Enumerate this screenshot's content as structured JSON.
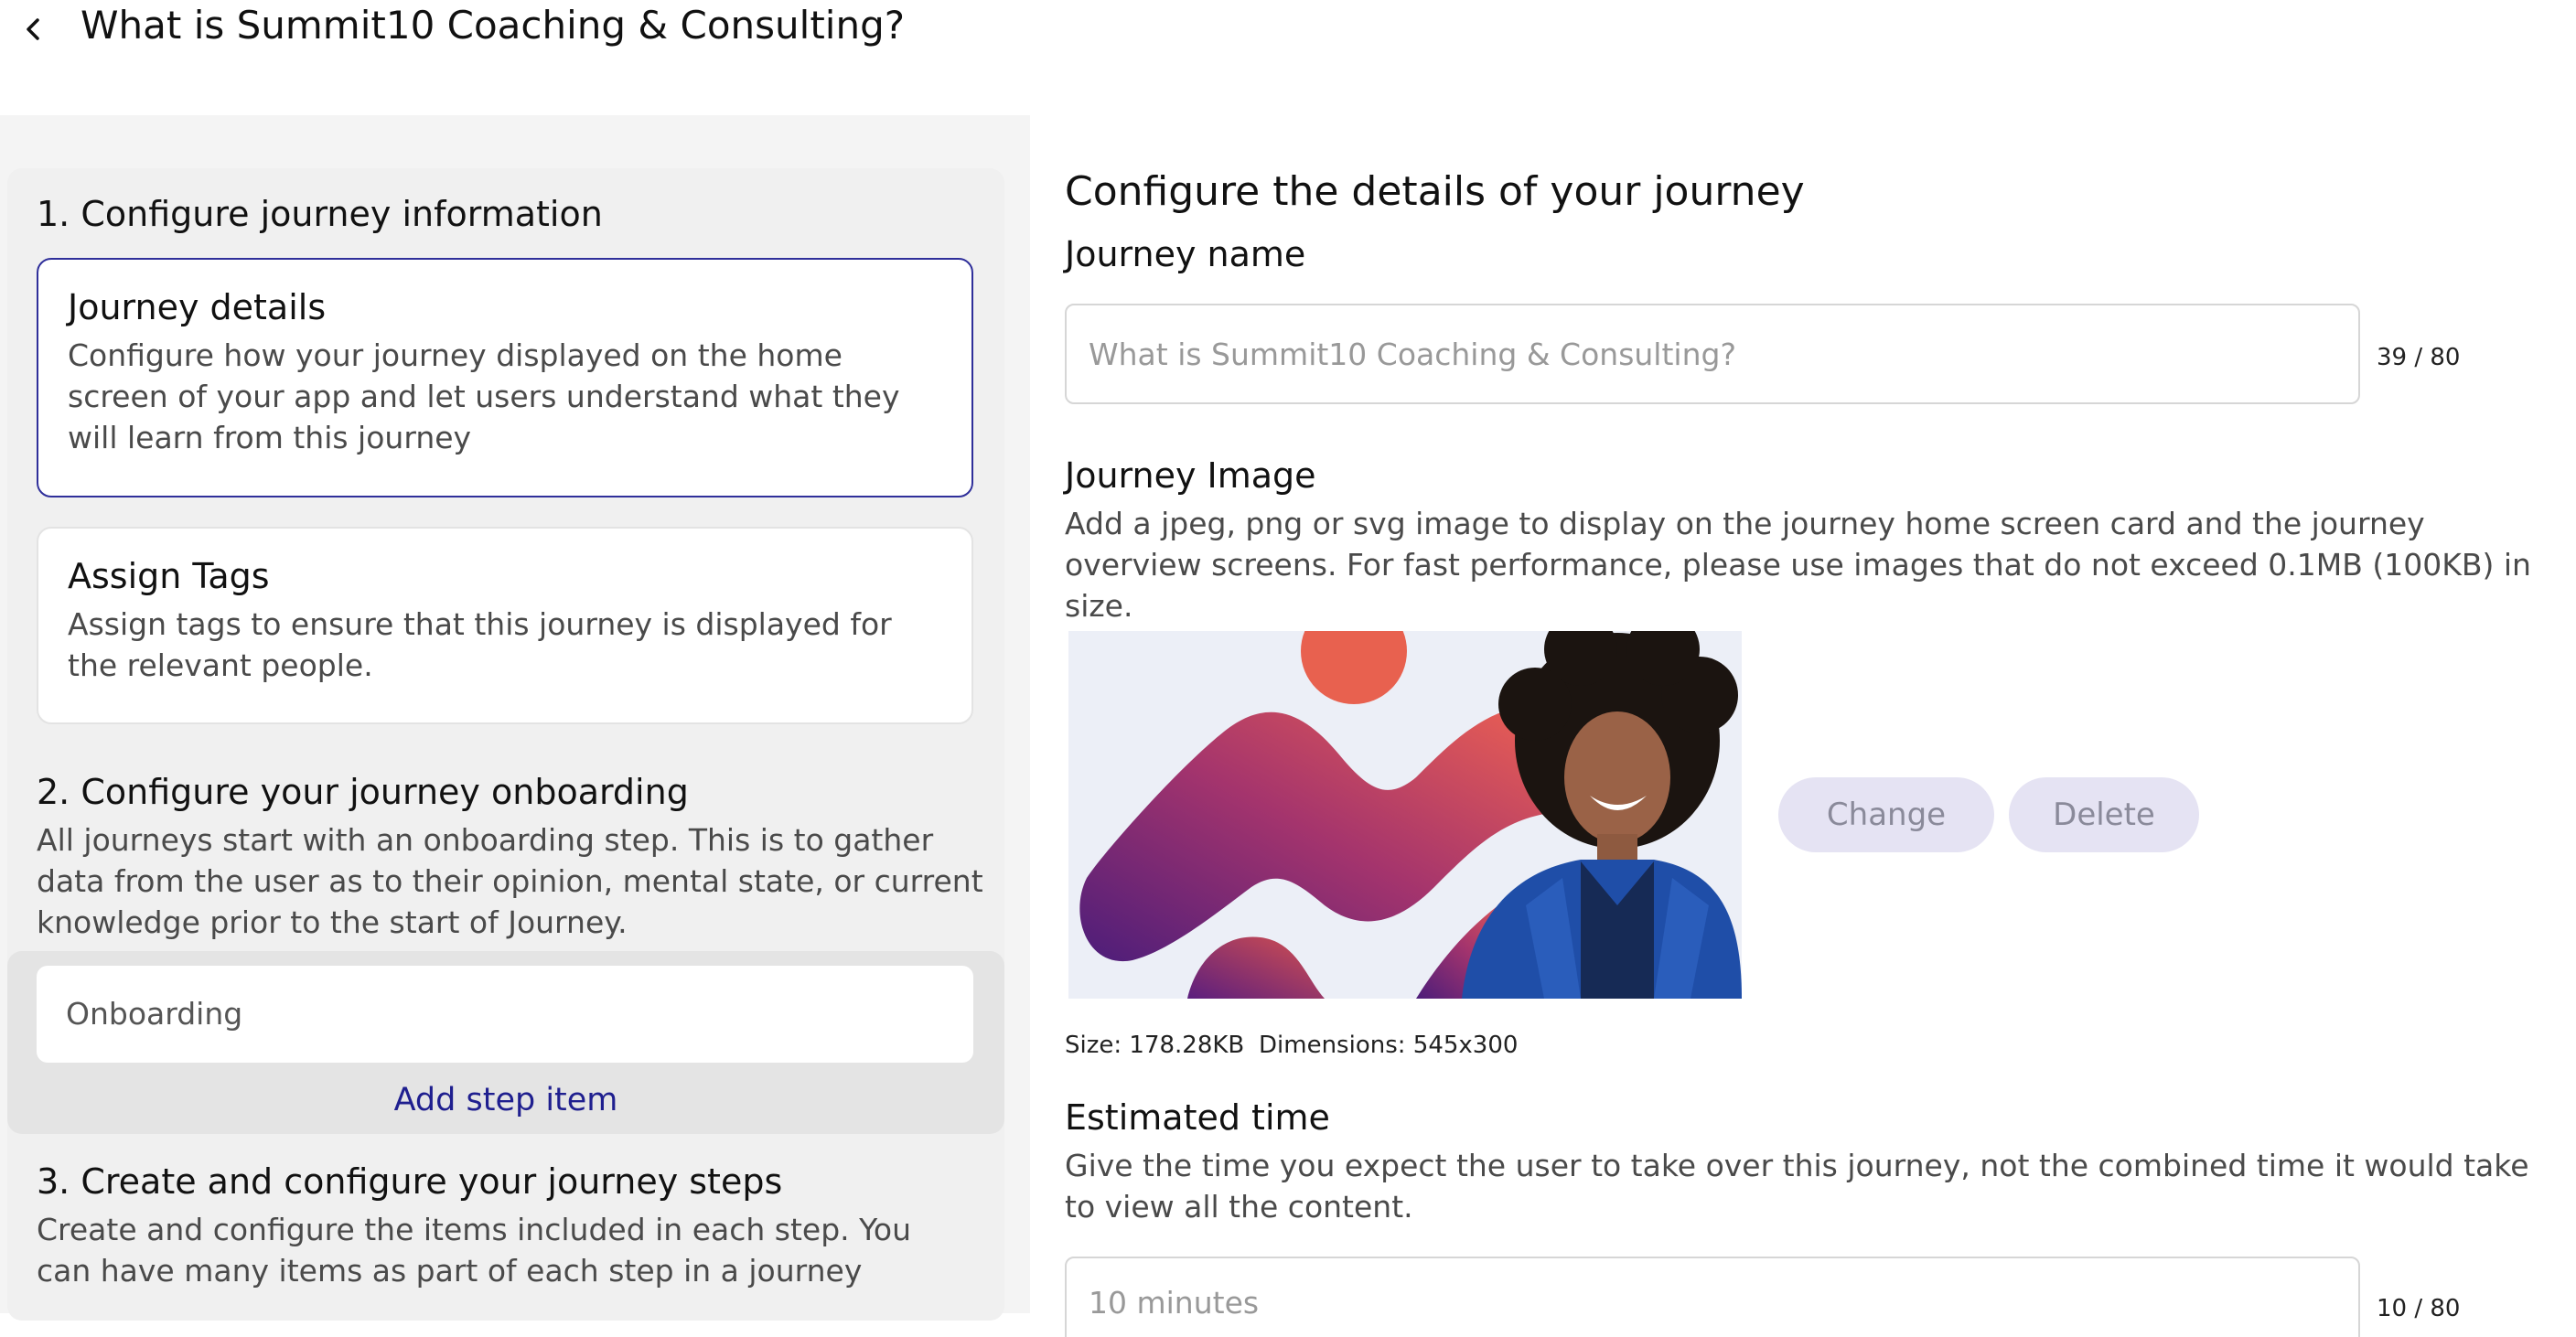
{
  "header": {
    "title": "What is Summit10 Coaching & Consulting?",
    "back_icon": "chevron-left-icon"
  },
  "left": {
    "section1": {
      "heading": "1. Configure journey information",
      "cards": [
        {
          "title": "Journey details",
          "desc": "Configure how your journey displayed on the home screen of your app and let users understand what they will learn from this journey",
          "selected": true
        },
        {
          "title": "Assign Tags",
          "desc": "Assign tags to ensure that this journey is displayed for the relevant people.",
          "selected": false
        }
      ]
    },
    "section2": {
      "heading": "2. Configure your journey onboarding",
      "desc": "All journeys start with an onboarding step. This is to gather data from the user as to their opinion, mental state, or current knowledge prior to the start of Journey.",
      "step_item": "Onboarding",
      "add_step": "Add step item"
    },
    "section3": {
      "heading": "3. Create and configure your journey steps",
      "desc": "Create and configure the items included in each step. You can have many items as part of each step in a journey"
    }
  },
  "right": {
    "heading": "Configure the details of your journey",
    "journey_name": {
      "label": "Journey name",
      "placeholder": "What is Summit10 Coaching & Consulting?",
      "counter": "39 / 80"
    },
    "journey_image": {
      "label": "Journey Image",
      "desc": "Add a jpeg, png or svg image to display on the journey home screen card and the journey overview screens. For fast performance, please use images that do not exceed 0.1MB (100KB) in size.",
      "change_label": "Change",
      "delete_label": "Delete",
      "size": "Size: 178.28KB",
      "dimensions": "Dimensions: 545x300"
    },
    "estimated_time": {
      "label": "Estimated time",
      "desc": "Give the time you expect the user to take over this journey, not the combined time it would take to view all the content.",
      "placeholder": "10 minutes",
      "counter": "10 / 80"
    }
  },
  "colors": {
    "accent": "#2f2f9a",
    "link": "#1f1f8f",
    "pill_bg": "#e5e3f3"
  }
}
